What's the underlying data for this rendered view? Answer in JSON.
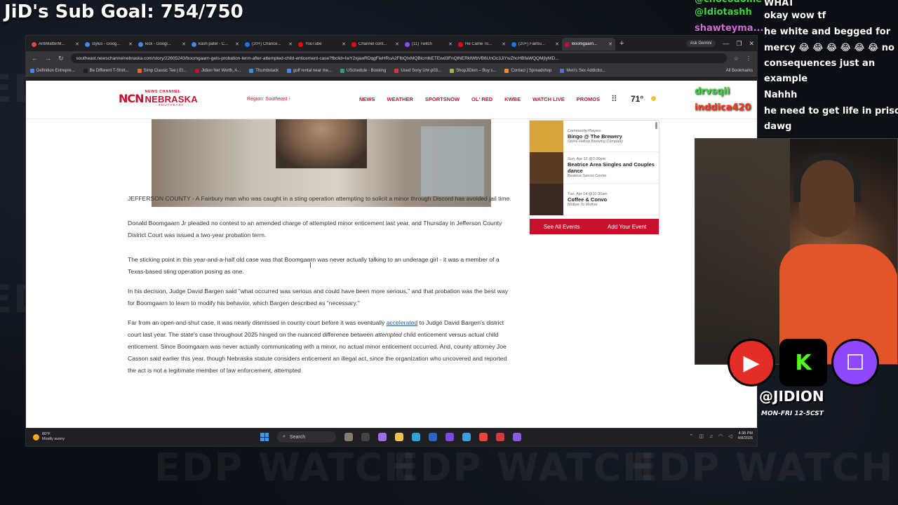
{
  "overlay": {
    "sub_goal": "JiD's Sub Goal: 754/750",
    "watermark": "EDP WATCH",
    "handle": "@JIDION",
    "schedule": "MON-FRI 12-5CST",
    "socials": [
      "youtube",
      "kick",
      "twitch"
    ]
  },
  "chat": {
    "lines": [
      {
        "user": "@chocodome",
        "text": "WHAT",
        "color": "#3cd63c"
      },
      {
        "user": "@Idiotashh",
        "text": "okay wow tf",
        "color": "#3cd63c"
      },
      {
        "user": "shawteyma...",
        "text": "he white and begged for",
        "color": "#d46ad4"
      },
      {
        "user": "",
        "text": "mercy 😂 😂 😂 😂 😂 😂 no",
        "color": ""
      },
      {
        "user": "",
        "text": "consequences just an",
        "color": ""
      },
      {
        "user": "",
        "text": "example",
        "color": ""
      },
      {
        "user": "drvsqii",
        "text": "Nahhh",
        "color": "#3cd63c"
      },
      {
        "user": "inddica420",
        "text": "he need to get life in prison",
        "color": "#ff3a1a"
      },
      {
        "user": "",
        "text": "dawg",
        "color": ""
      }
    ]
  },
  "browser": {
    "tabs": [
      {
        "label": "AntiMatterM...",
        "icon_color": "#e8453c"
      },
      {
        "label": "stylus - Goog...",
        "icon_color": "#4285f4"
      },
      {
        "label": "kick - Googl...",
        "icon_color": "#4285f4"
      },
      {
        "label": "kash patel - C...",
        "icon_color": "#4285f4"
      },
      {
        "label": "(20+) Chance...",
        "icon_color": "#1877f2"
      },
      {
        "label": "YouTube",
        "icon_color": "#ff0000"
      },
      {
        "label": "Channel cont...",
        "icon_color": "#ff0000"
      },
      {
        "label": "(11) Twitch",
        "icon_color": "#9146ff"
      },
      {
        "label": "He Came To...",
        "icon_color": "#ff0000"
      },
      {
        "label": "(20+) Fairbu...",
        "icon_color": "#1877f2"
      },
      {
        "label": "Boomgaarn...",
        "icon_color": "#c8102e",
        "active": true
      }
    ],
    "gemini_label": "Ask Gemini",
    "url": "southeast.newschannelnebraska.com/story/22605243/boomgaarn-gets-probation-term-after-attempted-child-enticement-case?fbclid=IwY2xjawRDqgFleHRuA2FlbQIxMQBicmlkETEwd3FnQlNERklWbVB6UnOc3JiYwZhcHBfaWQQMjIyMD...",
    "bookmarks": [
      {
        "label": "Definition Entrepre...",
        "color": "#4285f4"
      },
      {
        "label": "Be Different T-Shirt...",
        "color": "#222"
      },
      {
        "label": "Simp Classic Tee | Et...",
        "color": "#f1641e"
      },
      {
        "label": "Jidion Net Worth, A...",
        "color": "#c8102e"
      },
      {
        "label": "Thumbstack",
        "color": "#3a8fdc"
      },
      {
        "label": "golf rental near me...",
        "color": "#4285f4"
      },
      {
        "label": "USchedule - Booking",
        "color": "#2a9d8f"
      },
      {
        "label": "Used Sony Unr-p03...",
        "color": "#e53238"
      },
      {
        "label": "ShopJiDion – Buy s...",
        "color": "#96bf48"
      },
      {
        "label": "Contact | Spreadshop",
        "color": "#f28c28"
      },
      {
        "label": "Men's Sex Addictio...",
        "color": "#5b6bd6"
      }
    ],
    "all_bookmarks": "All Bookmarks"
  },
  "site": {
    "logo_top": "NEWS CHANNEL",
    "logo_main": "NEBRASKA",
    "logo_sub": "SOUTHEAST",
    "region": "Region: Southeast",
    "nav": [
      "NEWS",
      "WEATHER",
      "SPORTSNOW",
      "OL' RED",
      "KWBE",
      "WATCH LIVE",
      "PROMOS"
    ],
    "temperature": "71°",
    "events": [
      {
        "date": "Community Players",
        "title": "Bingo @ The Brewery",
        "venue": "",
        "img": "#d7a33a"
      },
      {
        "date": "Sun, Apr 12 @2:00pm",
        "title": "Beatrice Area Singles and Couples dance",
        "venue": "Beatrice Senior Center",
        "img": "#5a3a22"
      },
      {
        "date": "Tue, Apr 14 @10:00am",
        "title": "Coffee & Convo",
        "venue": "Mother To Mother",
        "img": "#3a2a22"
      }
    ],
    "events_venue_2": "Stone Hollow Brewing Company",
    "events_date_1": "Sun, Apr 12 @2:00pm",
    "see_all": "See All Events",
    "add_event": "Add Your Event",
    "article": {
      "p1": "JEFFERSON COUNTY - A Fairbury man who was caught in a sting operation attempting to solicit a minor through Discord has avoided jail time.",
      "p2": "Donald Boomgaarn Jr pleaded no contest to an amended charge of attempted minor enticement last year, and Thursday in Jefferson County District Court was issued a two-year probation term.",
      "p3": "The sticking point in this year-and-a-half old case was that Boomgaarn was never actually talking to an underage girl - it was a member of a Texas-based sting operation posing as one.",
      "p4": "In his decision, Judge David Bargen said \"what occurred was serious and could have been more serious,\" and that probation was the best way for Boomgaarn to learn to modify his behavior, which Bargen described as \"necessary.\"",
      "p5_a": "Far from an open-and-shut case, it was nearly dismissed in county court before it was eventually ",
      "p5_link": "accelerated",
      "p5_b": " to Judge David Bargen's district court last year. The state's case throughout 2025 hinged on the nuanced difference between ",
      "p5_em": "attempted",
      "p5_c": " child enticement versus actual child enticement. Since Boomgaarn was never actually communicating with a minor, no actual minor enticement occurred. And, county attorney Joe Casson said earlier this year, though Nebraska statute considers enticement an illegal act, since the organization who uncovered and reported the act is not a legitimate member of law enforcement, attempted"
    }
  },
  "taskbar": {
    "weather_temp": "80°F",
    "weather_desc": "Mostly sunny",
    "search": "Search",
    "time": "4:38 PM",
    "date": "4/8/2026"
  }
}
